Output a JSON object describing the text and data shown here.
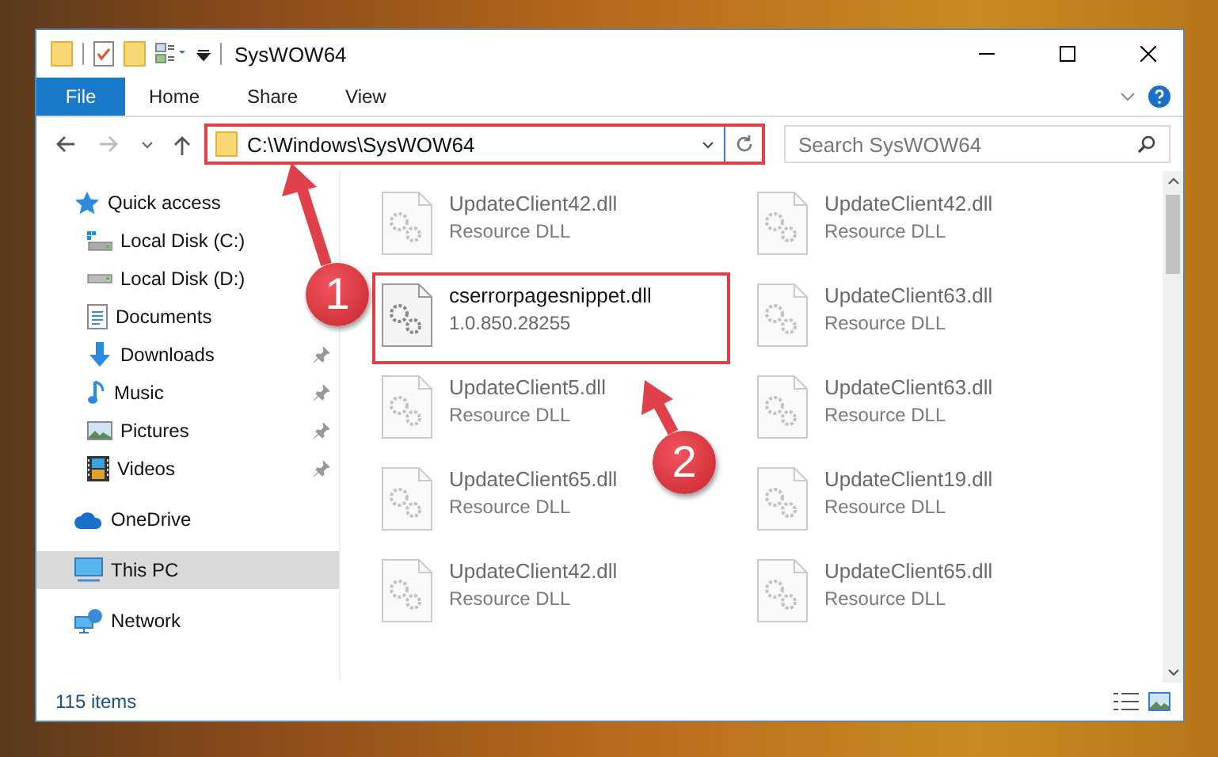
{
  "window": {
    "title": "SysWOW64"
  },
  "ribbon": {
    "tabs": [
      {
        "label": "File",
        "kind": "file"
      },
      {
        "label": "Home",
        "kind": "tab"
      },
      {
        "label": "Share",
        "kind": "tab"
      },
      {
        "label": "View",
        "kind": "tab"
      }
    ]
  },
  "address_bar": {
    "path": "C:\\Windows\\SysWOW64",
    "highlighted": true
  },
  "search": {
    "placeholder": "Search SysWOW64"
  },
  "navigation": {
    "items": [
      {
        "label": "Quick access",
        "kind": "star",
        "selected": false,
        "children": [
          {
            "label": "Local Disk (C:)",
            "kind": "system-drive",
            "pinned": false,
            "selected": false
          },
          {
            "label": "Local Disk (D:)",
            "kind": "drive",
            "pinned": false,
            "selected": false
          },
          {
            "label": "Documents",
            "kind": "documents",
            "pinned": false,
            "selected": false
          },
          {
            "label": "Downloads",
            "kind": "downloads",
            "pinned": true,
            "selected": false
          },
          {
            "label": "Music",
            "kind": "music",
            "pinned": true,
            "selected": false
          },
          {
            "label": "Pictures",
            "kind": "pictures",
            "pinned": true,
            "selected": false
          },
          {
            "label": "Videos",
            "kind": "videos",
            "pinned": true,
            "selected": false
          }
        ]
      },
      {
        "label": "OneDrive",
        "kind": "cloud",
        "selected": false
      },
      {
        "label": "This PC",
        "kind": "computer",
        "selected": true
      },
      {
        "label": "Network",
        "kind": "network",
        "selected": false
      }
    ]
  },
  "files": [
    {
      "name": "UpdateClient42.dll",
      "detail": "Resource DLL",
      "blurred": true,
      "highlighted": false
    },
    {
      "name": "UpdateClient42.dll",
      "detail": "Resource DLL",
      "blurred": true,
      "highlighted": false
    },
    {
      "name": "cserrorpagesnippet.dll",
      "detail": "1.0.850.28255",
      "blurred": false,
      "highlighted": true
    },
    {
      "name": "UpdateClient63.dll",
      "detail": "Resource DLL",
      "blurred": true,
      "highlighted": false
    },
    {
      "name": "UpdateClient5.dll",
      "detail": "Resource DLL",
      "blurred": true,
      "highlighted": false
    },
    {
      "name": "UpdateClient63.dll",
      "detail": "Resource DLL",
      "blurred": true,
      "highlighted": false
    },
    {
      "name": "UpdateClient65.dll",
      "detail": "Resource DLL",
      "blurred": true,
      "highlighted": false
    },
    {
      "name": "UpdateClient19.dll",
      "detail": "Resource DLL",
      "blurred": true,
      "highlighted": false
    },
    {
      "name": "UpdateClient42.dll",
      "detail": "Resource DLL",
      "blurred": true,
      "highlighted": false
    },
    {
      "name": "UpdateClient65.dll",
      "detail": "Resource DLL",
      "blurred": true,
      "highlighted": false
    }
  ],
  "status_bar": {
    "item_count": "115 items"
  },
  "annotations": [
    {
      "number": "1"
    },
    {
      "number": "2"
    }
  ]
}
